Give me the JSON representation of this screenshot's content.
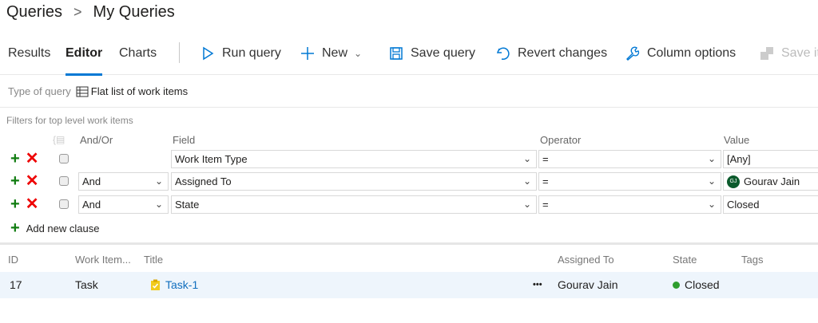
{
  "breadcrumb": {
    "root": "Queries",
    "current": "My Queries"
  },
  "tabs": [
    {
      "label": "Results"
    },
    {
      "label": "Editor",
      "active": true
    },
    {
      "label": "Charts"
    }
  ],
  "commands": {
    "run": "Run query",
    "new": "New",
    "save": "Save query",
    "revert": "Revert changes",
    "columns": "Column options",
    "save_items": "Save it"
  },
  "query_type": {
    "label": "Type of query",
    "value": "Flat list of work items"
  },
  "filters": {
    "label": "Filters for top level work items",
    "headers": {
      "andor": "And/Or",
      "field": "Field",
      "operator": "Operator",
      "value": "Value"
    },
    "clauses": [
      {
        "andor": "",
        "field": "Work Item Type",
        "operator": "=",
        "value": "[Any]"
      },
      {
        "andor": "And",
        "field": "Assigned To",
        "operator": "=",
        "value": "Gourav Jain",
        "avatar": "GJ"
      },
      {
        "andor": "And",
        "field": "State",
        "operator": "=",
        "value": "Closed"
      }
    ],
    "add_clause": "Add new clause"
  },
  "results": {
    "headers": {
      "id": "ID",
      "type": "Work Item...",
      "title": "Title",
      "assigned": "Assigned To",
      "state": "State",
      "tags": "Tags"
    },
    "rows": [
      {
        "id": "17",
        "type": "Task",
        "title": "Task-1",
        "assigned": "Gourav Jain",
        "state": "Closed",
        "more": "•••"
      }
    ]
  },
  "colors": {
    "accent": "#0078d4",
    "add": "#107c10",
    "remove": "#e00000",
    "closed": "#2e9e2e"
  }
}
